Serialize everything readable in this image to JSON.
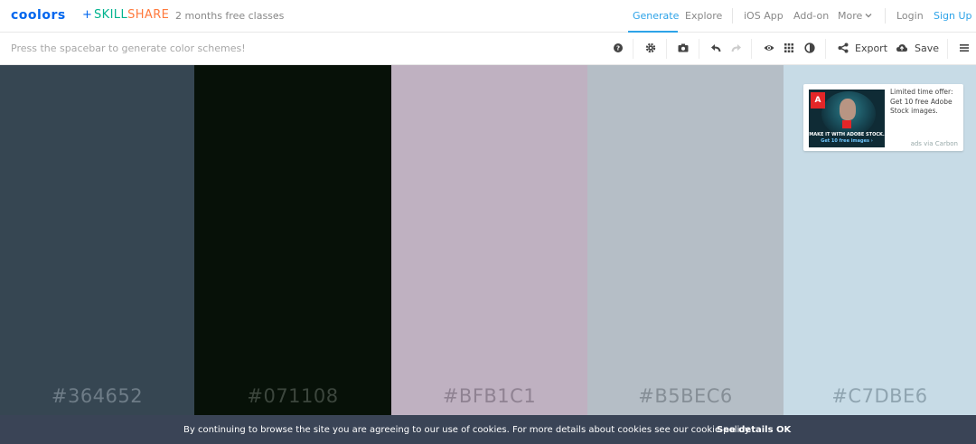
{
  "header": {
    "logo": "coolors",
    "plus": "+",
    "partner_a": "SKILL",
    "partner_b": "SHARE",
    "promo": "2 months free classes",
    "nav": {
      "generate": "Generate",
      "explore": "Explore",
      "ios_app": "iOS App",
      "addon": "Add-on",
      "more": "More",
      "login": "Login",
      "signup": "Sign Up"
    }
  },
  "toolbar": {
    "hint": "Press the spacebar to generate color schemes!",
    "export_label": "Export",
    "save_label": "Save",
    "icons": [
      "help-icon",
      "settings-icon",
      "camera-icon",
      "undo-icon",
      "redo-icon",
      "eye-icon",
      "grid-icon",
      "contrast-icon",
      "share-icon",
      "cloud-upload-icon",
      "menu-icon"
    ]
  },
  "palette": {
    "swatches": [
      {
        "hex": "#364652",
        "color": "#364652",
        "text_color": "#6e7c87"
      },
      {
        "hex": "#071108",
        "color": "#071108",
        "text_color": "#3c463d"
      },
      {
        "hex": "#BFB1C1",
        "color": "#BFB1C1",
        "text_color": "#8f8292"
      },
      {
        "hex": "#B5BEC6",
        "color": "#B5BEC6",
        "text_color": "#858e96"
      },
      {
        "hex": "#C7DBE6",
        "color": "#C7DBE6",
        "text_color": "#8fa4b0"
      }
    ]
  },
  "ad": {
    "text": "Limited time offer: Get 10 free Adobe Stock images.",
    "via": "ads via Carbon",
    "image_caption": "MAKE IT WITH ADOBE STOCK.",
    "image_sub": "Get 10 free images ›",
    "brand_mark": "A"
  },
  "cookie": {
    "text": "By continuing to browse the site you are agreeing to our use of cookies. For more details about cookies see our cookie policy.",
    "details": "See details",
    "ok": "OK"
  },
  "colors": {
    "accent": "#2da3e8",
    "logo": "#0066ee",
    "cookie_bg": "#3a4456"
  }
}
